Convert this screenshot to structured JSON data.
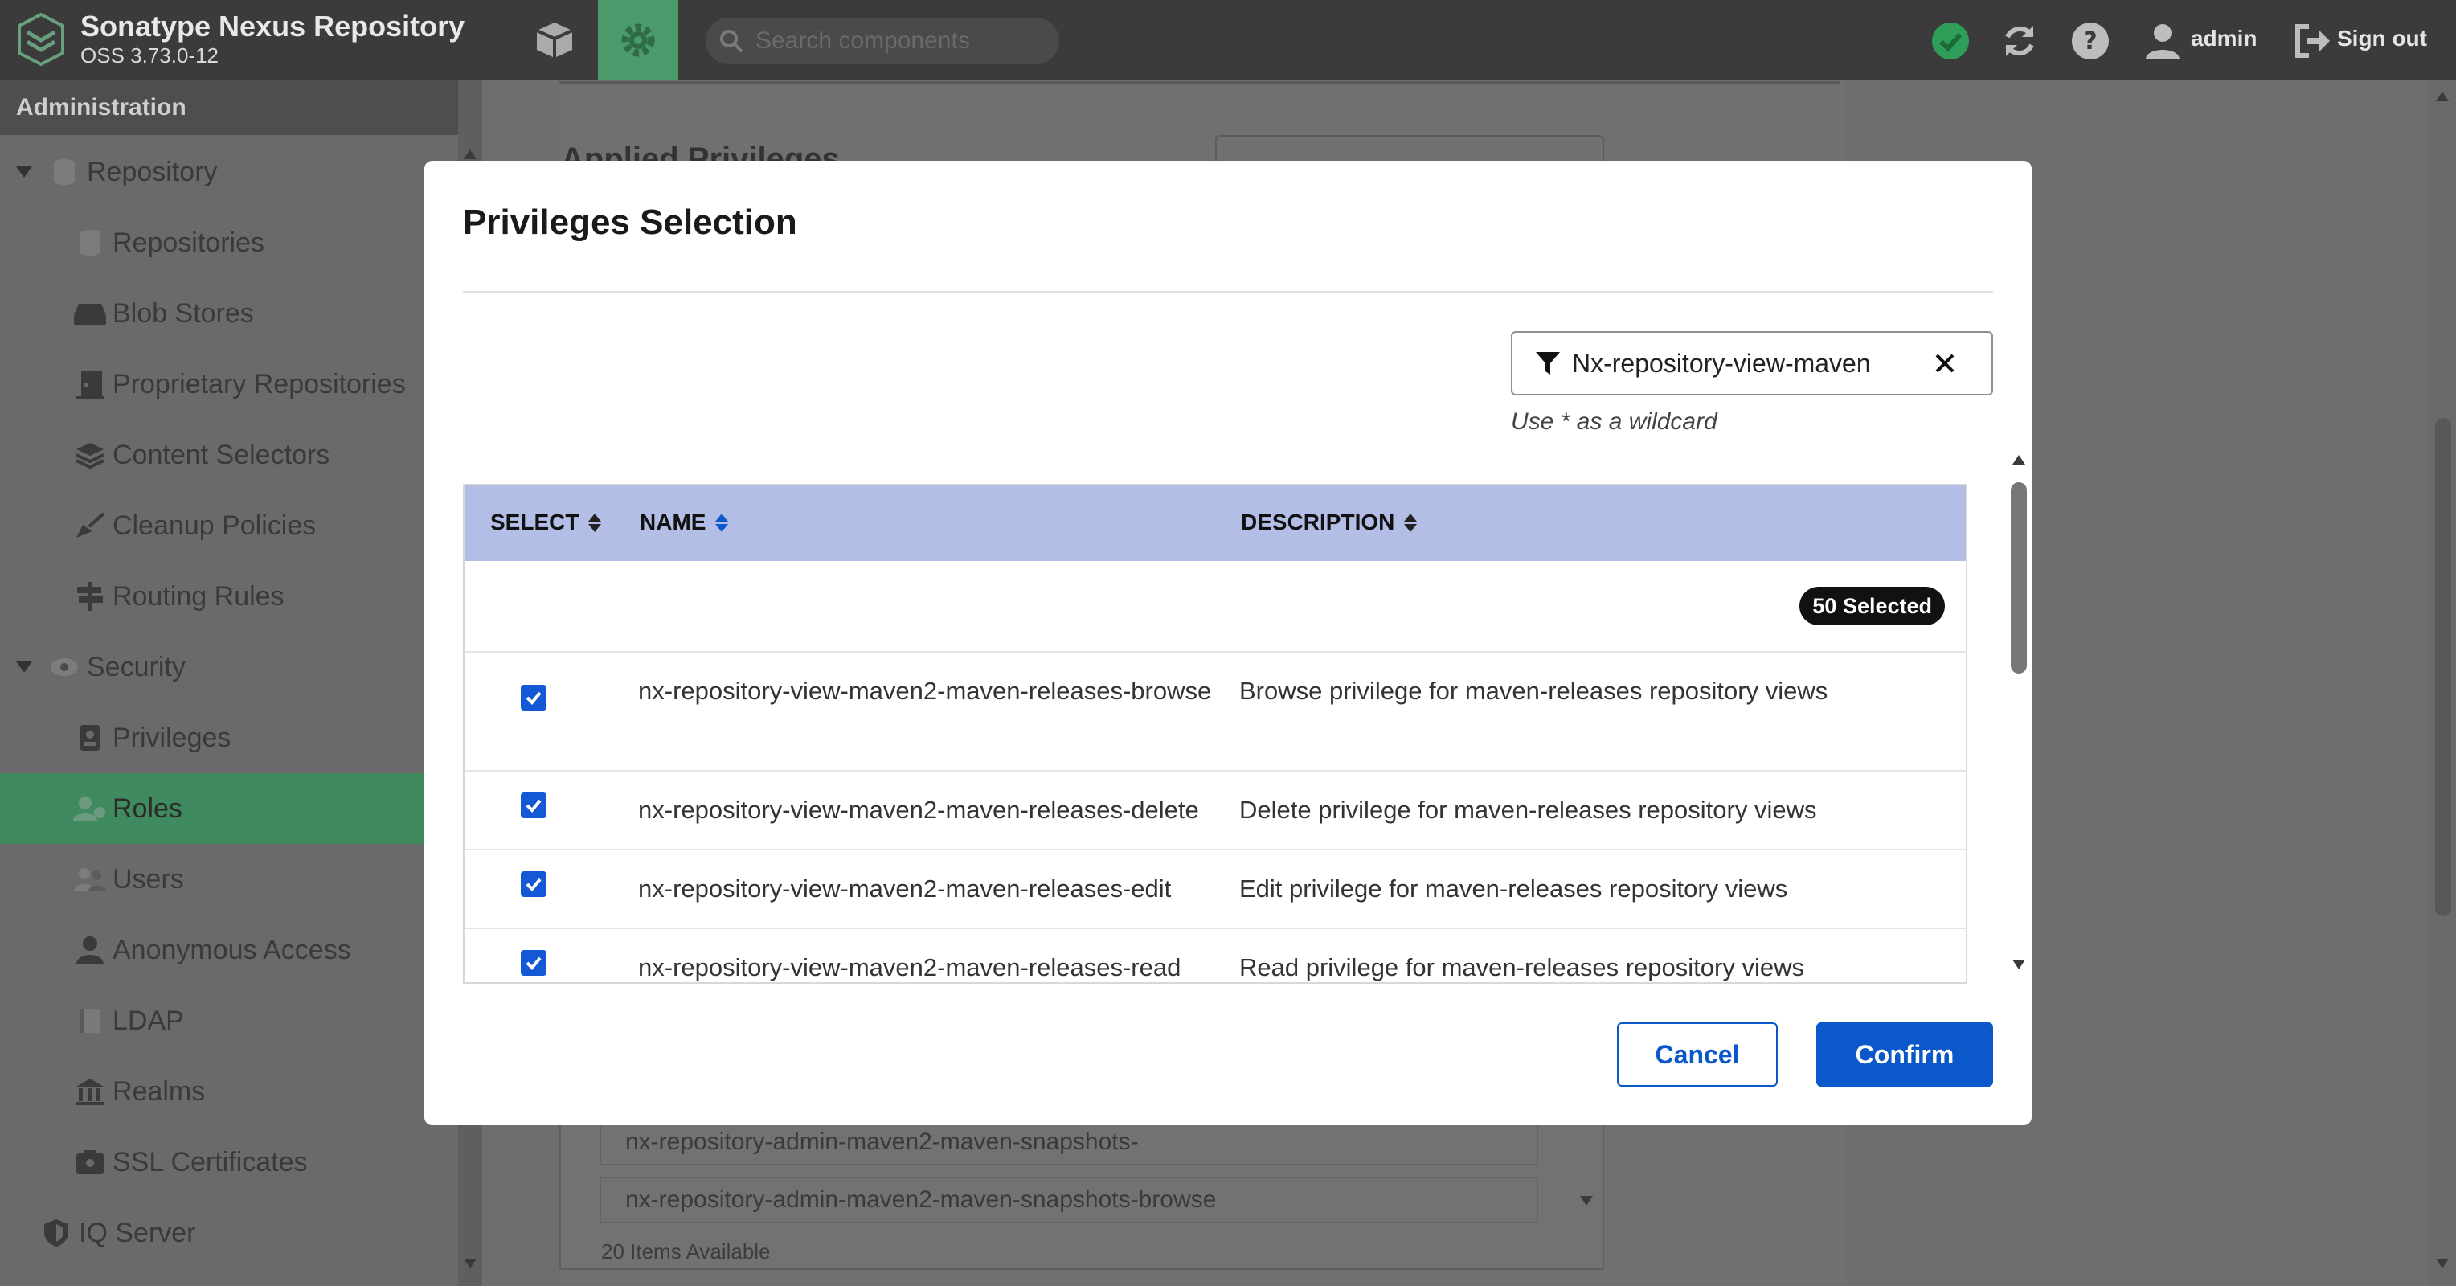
{
  "header": {
    "app_title": "Sonatype Nexus Repository",
    "version": "OSS 3.73.0-12",
    "search_placeholder": "Search components",
    "user_label": "admin",
    "signout_label": "Sign out",
    "icons": [
      "box-icon",
      "gear-icon",
      "search-icon",
      "status-check-icon",
      "refresh-icon",
      "help-icon",
      "user-icon",
      "sign-out-icon"
    ]
  },
  "sidebar": {
    "section_title": "Administration",
    "items": [
      {
        "label": "Repository",
        "kind": "group",
        "icon": "database-icon"
      },
      {
        "label": "Repositories",
        "kind": "child",
        "icon": "database-icon"
      },
      {
        "label": "Blob Stores",
        "kind": "child",
        "icon": "hard-drive-icon"
      },
      {
        "label": "Proprietary Repositories",
        "kind": "child",
        "icon": "door-icon"
      },
      {
        "label": "Content Selectors",
        "kind": "child",
        "icon": "layers-icon"
      },
      {
        "label": "Cleanup Policies",
        "kind": "child",
        "icon": "broom-icon"
      },
      {
        "label": "Routing Rules",
        "kind": "child",
        "icon": "signpost-icon"
      },
      {
        "label": "Security",
        "kind": "group",
        "icon": "eye-badge-icon"
      },
      {
        "label": "Privileges",
        "kind": "child",
        "icon": "id-badge-icon"
      },
      {
        "label": "Roles",
        "kind": "child",
        "icon": "user-group-icon",
        "active": true
      },
      {
        "label": "Users",
        "kind": "child",
        "icon": "users-icon"
      },
      {
        "label": "Anonymous Access",
        "kind": "child",
        "icon": "person-icon"
      },
      {
        "label": "LDAP",
        "kind": "child",
        "icon": "book-icon"
      },
      {
        "label": "Realms",
        "kind": "child",
        "icon": "building-icon"
      },
      {
        "label": "SSL Certificates",
        "kind": "child",
        "icon": "certificate-icon"
      },
      {
        "label": "IQ Server",
        "kind": "top",
        "icon": "shield-icon"
      }
    ]
  },
  "background": {
    "heading": "Applied Privileges",
    "list_items": [
      "nx-repository-admin-maven2-maven-snapshots-",
      "nx-repository-admin-maven2-maven-snapshots-browse"
    ],
    "list_footer": "20 Items Available"
  },
  "modal": {
    "title": "Privileges Selection",
    "filter_value": "Nx-repository-view-maven",
    "filter_hint": "Use * as a wildcard",
    "columns": [
      "SELECT",
      "NAME",
      "DESCRIPTION"
    ],
    "selected_badge": "50 Selected",
    "rows": [
      {
        "checked": true,
        "name": "nx-repository-view-maven2-maven-releases-browse",
        "description": "Browse privilege for maven-releases repository views"
      },
      {
        "checked": true,
        "name": "nx-repository-view-maven2-maven-releases-delete",
        "description": "Delete privilege for maven-releases repository views"
      },
      {
        "checked": true,
        "name": "nx-repository-view-maven2-maven-releases-edit",
        "description": "Edit privilege for maven-releases repository views"
      },
      {
        "checked": true,
        "name": "nx-repository-view-maven2-maven-releases-read",
        "description": "Read privilege for maven-releases repository views"
      }
    ],
    "cancel_label": "Cancel",
    "confirm_label": "Confirm"
  },
  "colors": {
    "header_bg": "#3b3b3b",
    "accent_green": "#4b9a6b",
    "primary_blue": "#0a58ca",
    "grid_header": "#b2bee6",
    "status_ok": "#2e9e58"
  }
}
